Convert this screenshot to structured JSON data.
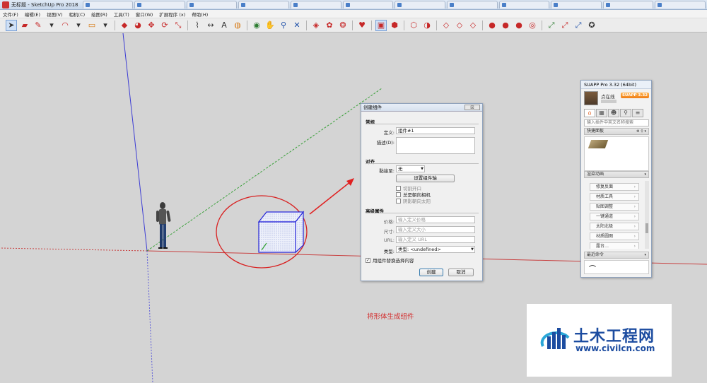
{
  "window": {
    "title": "无标题 - SketchUp Pro 2018",
    "tabs": [
      "",
      "",
      "",
      "",
      "",
      "",
      "",
      "",
      "",
      "",
      "",
      ""
    ]
  },
  "menu": [
    "文件(F)",
    "编辑(E)",
    "视图(V)",
    "相机(C)",
    "绘图(R)",
    "工具(T)",
    "窗口(W)",
    "扩展程序 (x)",
    "帮助(H)"
  ],
  "dialog": {
    "title": "创建组件",
    "close_label": "☒",
    "general_header": "常规",
    "definition_label": "定义:",
    "definition_value": "组件#1",
    "description_label": "描述(D):",
    "align_header": "对齐",
    "glue_label": "黏接至:",
    "glue_value": "无",
    "set_axes_label": "设置组件轴",
    "cut_opening_label": "切割开口",
    "face_camera_label": "总是朝向相机",
    "shadows_face_sun_label": "阴影朝向太阳",
    "advanced_header": "高级属性",
    "price_label": "价格:",
    "price_placeholder": "输入定义价格",
    "size_label": "尺寸:",
    "size_placeholder": "输入定义大小",
    "url_label": "URL:",
    "url_placeholder": "输入定义 URL",
    "type_label": "类型:",
    "type_value": "类型: <undefined>",
    "replace_selection_label": "用组件替换选择内容",
    "create_label": "创建",
    "cancel_label": "取消"
  },
  "suapp": {
    "title": "SUAPP Pro 3.32 (64bit)",
    "user_name": "点在线",
    "badge": "SUAPP 3.32",
    "search_placeholder": "输入插件中英文名称搜索",
    "favorites_label": "快捷面板",
    "category_label": "渲染动画",
    "items": [
      "修复反面",
      "材质工具",
      "贴图调整",
      "一键通道",
      "太阳北极",
      "材质圆图",
      "露台…"
    ],
    "recent_label": "最近命令"
  },
  "caption": "将形体生成组件",
  "watermark": {
    "cn": "土木工程网",
    "url": "www.civilcn.com"
  }
}
